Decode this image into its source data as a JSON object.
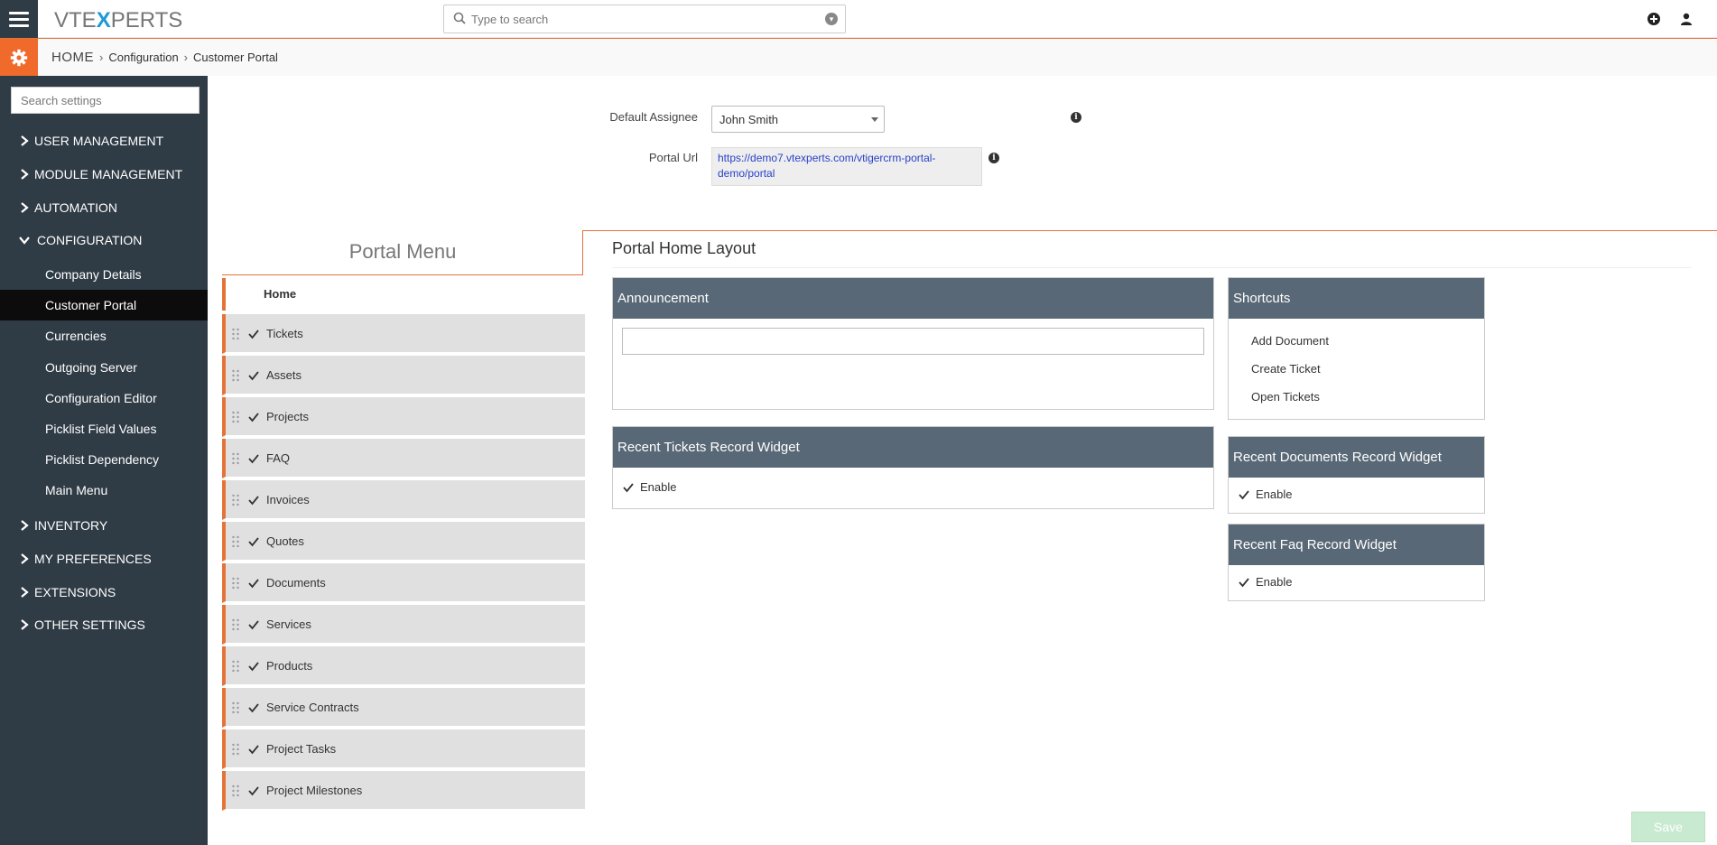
{
  "header": {
    "logo": {
      "pre": "VTE",
      "x": "X",
      "post": "PERTS"
    },
    "search_placeholder": "Type to search"
  },
  "breadcrumb": {
    "home": "HOME",
    "items": [
      "Configuration",
      "Customer Portal"
    ]
  },
  "sidebar": {
    "search_placeholder": "Search settings",
    "sections": [
      {
        "label": "USER MANAGEMENT",
        "expanded": false
      },
      {
        "label": "MODULE MANAGEMENT",
        "expanded": false
      },
      {
        "label": "AUTOMATION",
        "expanded": false
      },
      {
        "label": "CONFIGURATION",
        "expanded": true
      },
      {
        "label": "INVENTORY",
        "expanded": false
      },
      {
        "label": "MY PREFERENCES",
        "expanded": false
      },
      {
        "label": "EXTENSIONS",
        "expanded": false
      },
      {
        "label": "OTHER SETTINGS",
        "expanded": false
      }
    ],
    "config_items": [
      {
        "label": "Company Details",
        "active": false
      },
      {
        "label": "Customer Portal",
        "active": true
      },
      {
        "label": "Currencies",
        "active": false
      },
      {
        "label": "Outgoing Server",
        "active": false
      },
      {
        "label": "Configuration Editor",
        "active": false
      },
      {
        "label": "Picklist Field Values",
        "active": false
      },
      {
        "label": "Picklist Dependency",
        "active": false
      },
      {
        "label": "Main Menu",
        "active": false
      }
    ]
  },
  "form": {
    "default_assignee_label": "Default Assignee",
    "default_assignee_value": "John Smith",
    "portal_url_label": "Portal Url",
    "portal_url_line1": "https://demo7.vtexperts.com/vtigercrm-portal-",
    "portal_url_line2": "demo/portal"
  },
  "portal_menu": {
    "title": "Portal Menu",
    "home": "Home",
    "items": [
      {
        "label": "Tickets",
        "checked": true
      },
      {
        "label": "Assets",
        "checked": true
      },
      {
        "label": "Projects",
        "checked": true
      },
      {
        "label": "FAQ",
        "checked": true
      },
      {
        "label": "Invoices",
        "checked": true
      },
      {
        "label": "Quotes",
        "checked": true
      },
      {
        "label": "Documents",
        "checked": true
      },
      {
        "label": "Services",
        "checked": true
      },
      {
        "label": "Products",
        "checked": true
      },
      {
        "label": "Service Contracts",
        "checked": true
      },
      {
        "label": "Project Tasks",
        "checked": true
      },
      {
        "label": "Project Milestones",
        "checked": true
      }
    ]
  },
  "home_layout": {
    "title": "Portal Home Layout",
    "announcement": {
      "header": "Announcement",
      "value": ""
    },
    "recent_tickets": {
      "header": "Recent Tickets Record Widget",
      "enable_label": "Enable",
      "enabled": true
    },
    "shortcuts": {
      "header": "Shortcuts",
      "items": [
        "Add Document",
        "Create Ticket",
        "Open Tickets"
      ]
    },
    "recent_documents": {
      "header": "Recent Documents Record Widget",
      "enable_label": "Enable",
      "enabled": true
    },
    "recent_faq": {
      "header": "Recent Faq Record Widget",
      "enable_label": "Enable",
      "enabled": true
    }
  },
  "save_label": "Save",
  "colors": {
    "accent": "#e57338",
    "sidebar_bg": "#2f3b45",
    "widget_header": "#596876",
    "save_disabled": "#c8ead0"
  }
}
